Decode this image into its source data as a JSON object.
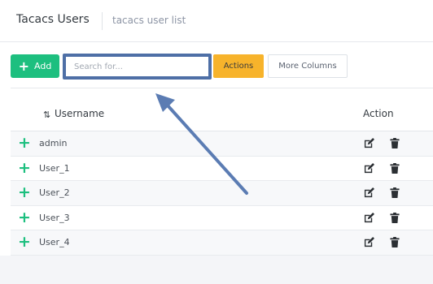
{
  "header": {
    "title": "Tacacs Users",
    "subtitle": "tacacs user list"
  },
  "toolbar": {
    "add_label": "Add",
    "search_placeholder": "Search for...",
    "actions_label": "Actions",
    "more_columns_label": "More Columns"
  },
  "table": {
    "columns": {
      "username": "Username",
      "action": "Action"
    },
    "rows": [
      {
        "username": "admin"
      },
      {
        "username": "User_1"
      },
      {
        "username": "User_2"
      },
      {
        "username": "User_3"
      },
      {
        "username": "User_4"
      }
    ]
  },
  "icons": {
    "add": "plus-icon",
    "sort": "sort-ascending-icon",
    "expand": "plus-icon",
    "edit": "edit-icon",
    "delete": "trash-icon",
    "annotation": "arrow-icon"
  },
  "colors": {
    "accent_green": "#1dbf7f",
    "actions_orange": "#f7b32b",
    "highlight_blue": "#4e6fa6"
  }
}
